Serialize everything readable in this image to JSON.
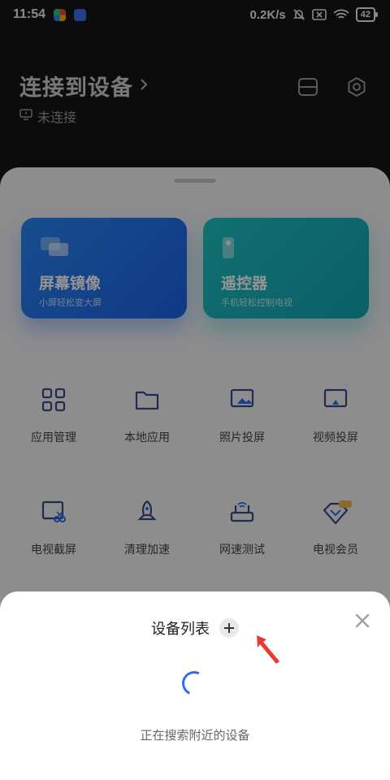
{
  "status_bar": {
    "time": "11:54",
    "speed": "0.2K/s",
    "battery": "42"
  },
  "header": {
    "title": "连接到设备",
    "connection_status": "未连接"
  },
  "cards": [
    {
      "title": "屏幕镜像",
      "subtitle": "小屏轻松变大屏",
      "color": "#2a86f3"
    },
    {
      "title": "遥控器",
      "subtitle": "手机轻松控制电视",
      "color": "#1ec2c3"
    }
  ],
  "grid": [
    {
      "label": "应用管理",
      "icon": "grid-apps-icon"
    },
    {
      "label": "本地应用",
      "icon": "folder-icon"
    },
    {
      "label": "照片投屏",
      "icon": "photo-cast-icon"
    },
    {
      "label": "视频投屏",
      "icon": "video-cast-icon"
    },
    {
      "label": "电视截屏",
      "icon": "tv-screenshot-icon"
    },
    {
      "label": "清理加速",
      "icon": "rocket-icon"
    },
    {
      "label": "网速测试",
      "icon": "router-icon"
    },
    {
      "label": "电视会员",
      "icon": "vip-diamond-icon"
    }
  ],
  "modal": {
    "title": "设备列表",
    "searching_text": "正在搜索附近的设备"
  },
  "colors": {
    "accent": "#2e6cf2",
    "annotation_arrow": "#e83a2f"
  }
}
